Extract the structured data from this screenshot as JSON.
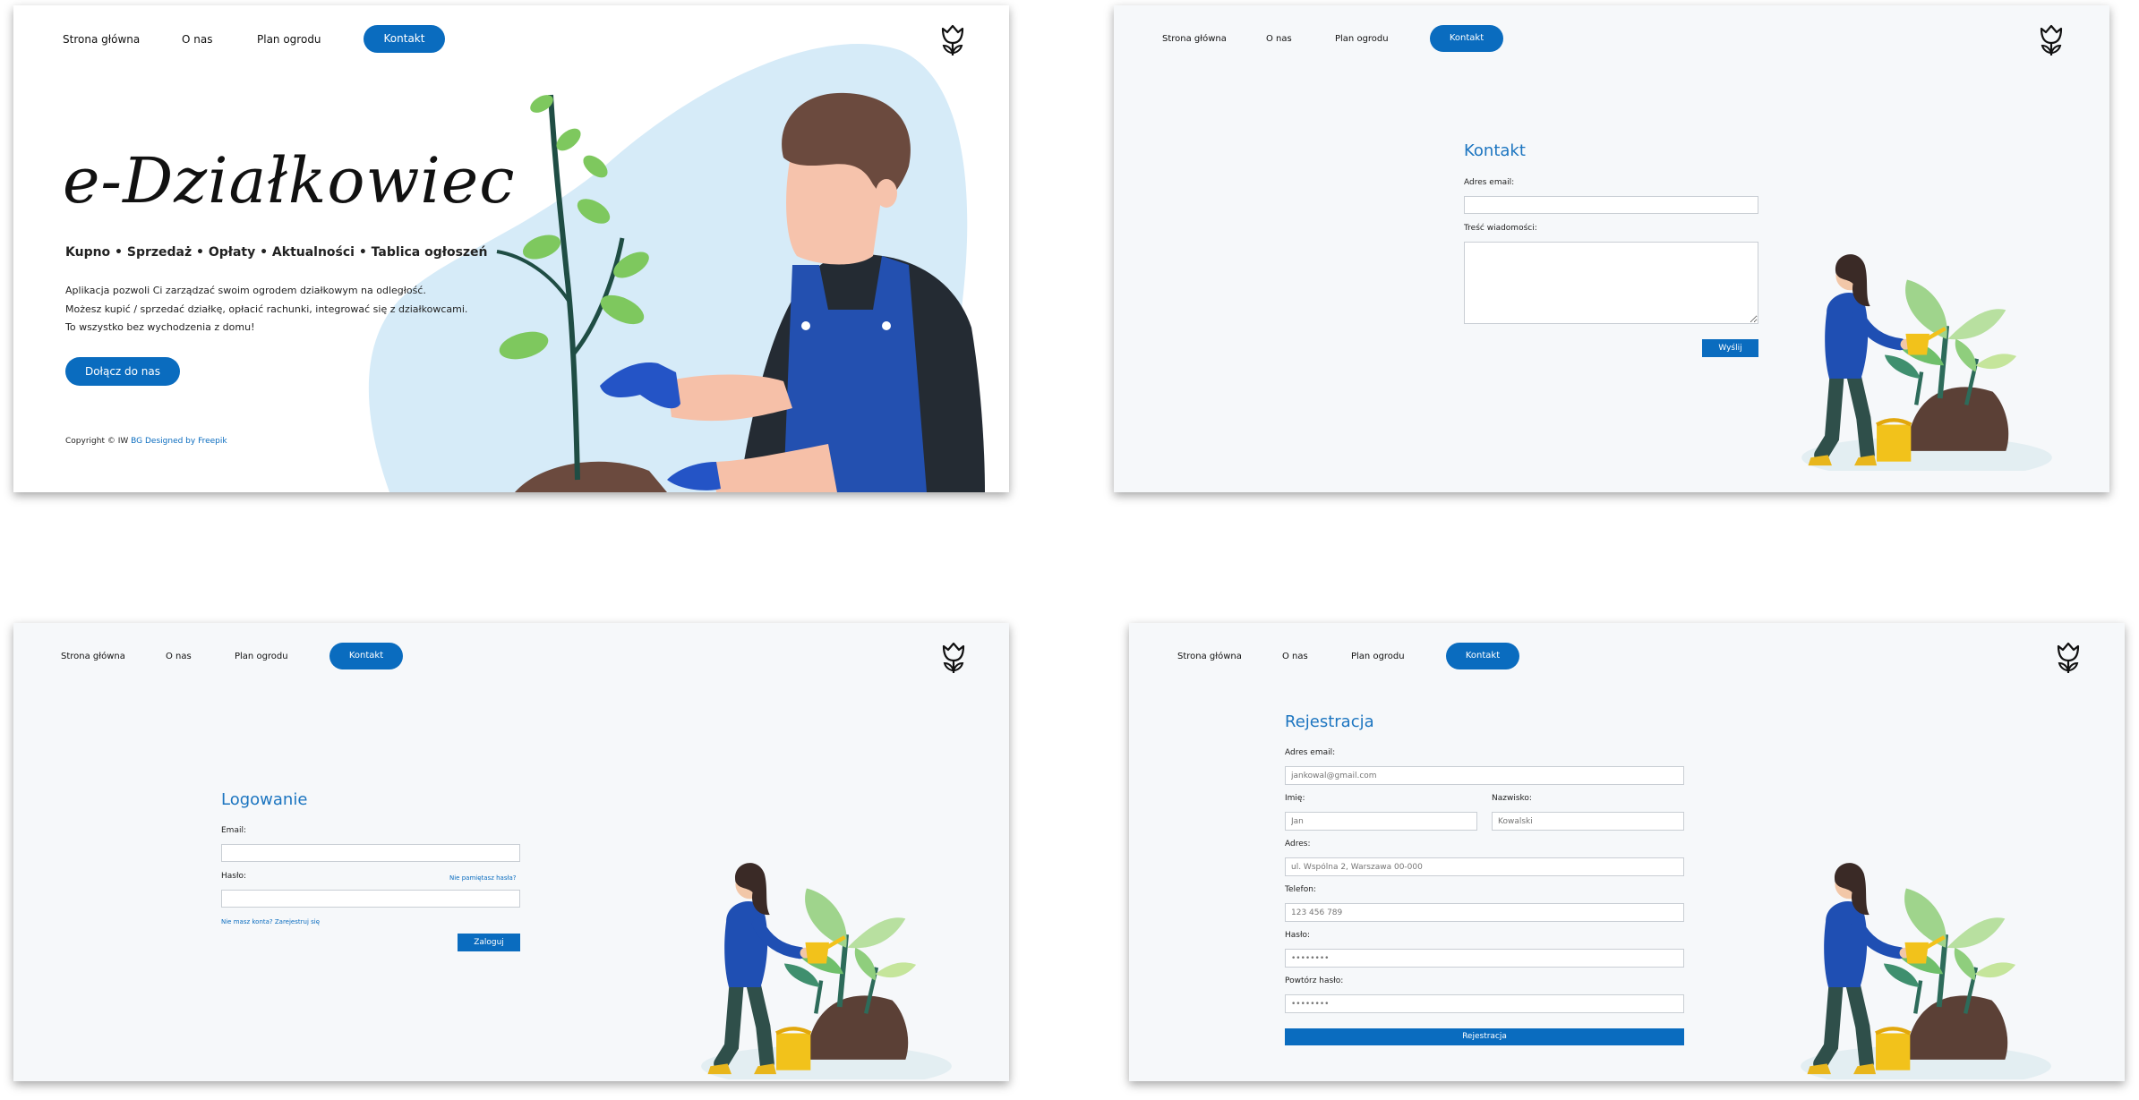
{
  "nav": {
    "home": "Strona główna",
    "about": "O nas",
    "plan": "Plan ogrodu",
    "contact": "Kontakt"
  },
  "landing": {
    "title": "e-Działkowiec",
    "features": "Kupno • Sprzedaż • Opłaty • Aktualności • Tablica ogłoszeń",
    "desc_1": "Aplikacja pozwoli Ci zarządzać swoim ogrodem działkowym na odległość.",
    "desc_2": "Możesz kupić / sprzedać działkę, opłacić rachunki, integrować się z działkowcami.",
    "desc_3": "To wszystko bez wychodzenia z domu!",
    "join_button": "Dołącz do nas",
    "copyright": "Copyright © IW",
    "credit": "BG Designed by Freepik"
  },
  "contact_form": {
    "title": "Kontakt",
    "email_label": "Adres email:",
    "message_label": "Treść wiadomości:",
    "send_button": "Wyślij"
  },
  "login_form": {
    "title": "Logowanie",
    "email_label": "Email:",
    "password_label": "Hasło:",
    "forgot_link": "Nie pamiętasz hasła?",
    "no_account": "Nie masz konta? Zarejestruj się",
    "login_button": "Zaloguj"
  },
  "register_form": {
    "title": "Rejestracja",
    "email_label": "Adres email:",
    "email_placeholder": "jankowal@gmail.com",
    "first_name_label": "Imię:",
    "first_name_placeholder": "Jan",
    "last_name_label": "Nazwisko:",
    "last_name_placeholder": "Kowalski",
    "address_label": "Adres:",
    "address_placeholder": "ul. Wspólna 2, Warszawa 00-000",
    "phone_label": "Telefon:",
    "phone_placeholder": "123 456 789",
    "password_label": "Hasło:",
    "password_placeholder": "••••••••",
    "repeat_password_label": "Powtórz hasło:",
    "repeat_password_placeholder": "••••••••",
    "register_button": "Rejestracja"
  },
  "colors": {
    "primary": "#0a6cbf",
    "title_blue": "#1c75c0",
    "panel_bg": "#f6f8fa",
    "blob": "#d6ebf8"
  },
  "icons": {
    "logo": "tulip-icon",
    "hero": "gardener-illustration",
    "side": "watering-woman-illustration"
  }
}
